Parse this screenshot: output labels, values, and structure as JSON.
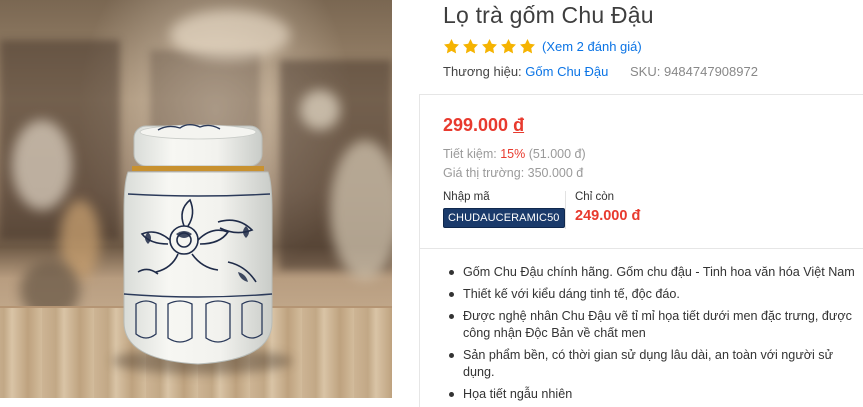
{
  "product": {
    "title": "Lọ trà gốm Chu Đậu",
    "rating": 5,
    "rating_max": 5,
    "review_link": "(Xem 2 đánh giá)",
    "brand_label": "Thương hiệu: ",
    "brand_name": "Gốm Chu Đậu",
    "sku_label": "SKU: ",
    "sku_value": "9484747908972",
    "image_alt": "Lọ trà gốm Chu Đậu"
  },
  "pricing": {
    "current_price": "299.000",
    "currency_symbol": "đ",
    "saving_label": "Tiết kiệm: ",
    "saving_percent": "15%",
    "saving_amount": " (51.000 đ)",
    "market_price": "Giá thị trường: 350.000 đ"
  },
  "coupon": {
    "label": "Nhập mã",
    "code": "CHUDAUCERAMIC50",
    "remain_label": "Chỉ còn",
    "remain_price": "249.000 đ"
  },
  "features": [
    "Gốm Chu Đậu chính hãng. Gốm chu đậu - Tinh hoa văn hóa Việt Nam",
    "Thiết kế với kiểu dáng tinh tế, độc đáo.",
    "Được nghệ nhân Chu Đậu vẽ tỉ mỉ họa tiết dưới men đặc trưng, được công nhận Độc Bản về chất men",
    "Sản phẩm bền, có thời gian sử dụng lâu dài, an toàn với người sử dụng.",
    "Họa tiết ngẫu nhiên"
  ],
  "colors": {
    "price_red": "#e83a2e",
    "link_blue": "#0b74e5",
    "star_gold": "#f5b301",
    "coupon_navy": "#1a3a6b"
  },
  "icons": {
    "star": "star-icon"
  }
}
